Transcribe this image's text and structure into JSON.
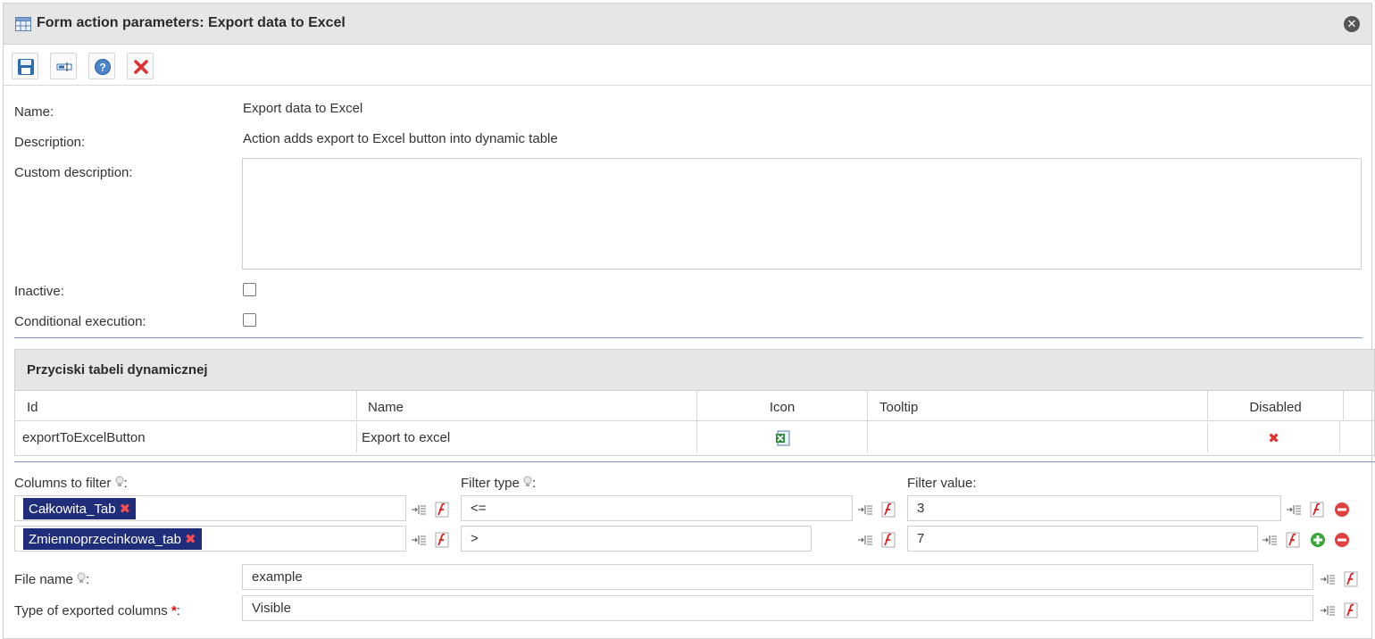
{
  "dialog": {
    "title": "Form action parameters: Export data to Excel",
    "close_label": "✕"
  },
  "toolbar": {
    "buttons": [
      "save",
      "rename",
      "help",
      "delete"
    ]
  },
  "form": {
    "name_label": "Name:",
    "name_value": "Export data to Excel",
    "description_label": "Description:",
    "description_value": "Action adds export to Excel button into dynamic table",
    "custom_description_label": "Custom description:",
    "custom_description_value": "",
    "inactive_label": "Inactive:",
    "inactive_checked": false,
    "conditional_label": "Conditional execution:",
    "conditional_checked": false
  },
  "buttons_table": {
    "title": "Przyciski tabeli dynamicznej",
    "columns": [
      "Id",
      "Name",
      "Icon",
      "Tooltip",
      "Disabled"
    ],
    "rows": [
      {
        "id": "exportToExcelButton",
        "name": "Export to excel",
        "icon": "excel-icon",
        "tooltip": "",
        "disabled": "✖"
      }
    ]
  },
  "filters": {
    "columns_label": "Columns to filter",
    "type_label": "Filter type",
    "value_label": "Filter value:",
    "colon": ":",
    "rows": [
      {
        "column": "Całkowita_Tab",
        "type": "<=",
        "value": "3"
      },
      {
        "column": "Zmiennoprzecinkowa_tab",
        "type": ">",
        "value": "7"
      }
    ],
    "tag_remove": "✖"
  },
  "export": {
    "file_name_label": "File name",
    "file_name_value": "example",
    "type_label": "Type of exported columns",
    "required_mark": "*",
    "type_value": "Visible"
  },
  "colors": {
    "tag_bg": "#1f2d7a",
    "remove_red": "#e04040",
    "add_green": "#3aa63a"
  }
}
